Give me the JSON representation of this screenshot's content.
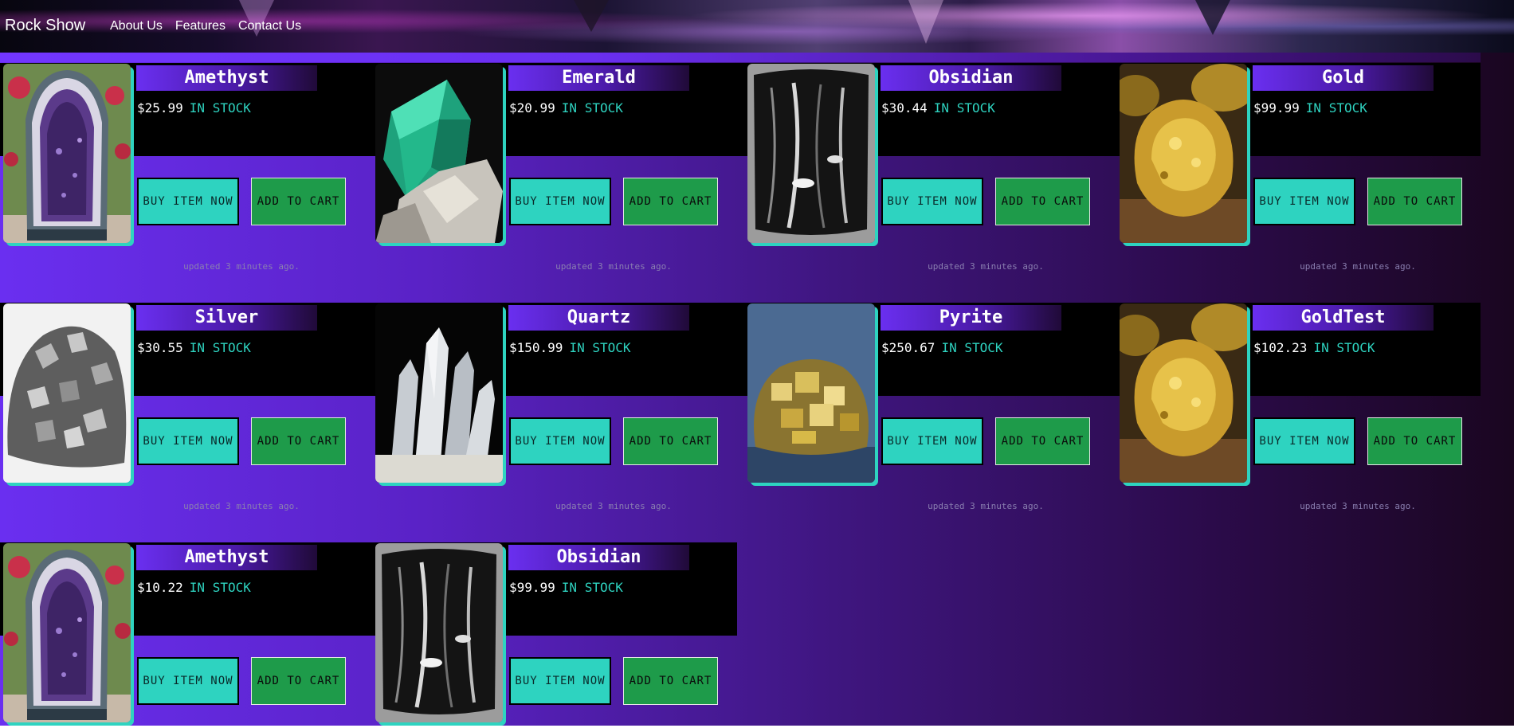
{
  "header": {
    "brand": "Rock Show",
    "nav": [
      "About Us",
      "Features",
      "Contact Us"
    ]
  },
  "products": [
    {
      "name": "Amethyst",
      "price": "$25.99",
      "stock": "IN STOCK",
      "buy": "BUY ITEM NOW",
      "cart": "ADD TO CART",
      "updated": "updated 3 minutes ago.",
      "image": "amethyst-geode"
    },
    {
      "name": "Emerald",
      "price": "$20.99",
      "stock": "IN STOCK",
      "buy": "BUY ITEM NOW",
      "cart": "ADD TO CART",
      "updated": "updated 3 minutes ago.",
      "image": "emerald-crystal"
    },
    {
      "name": "Obsidian",
      "price": "$30.44",
      "stock": "IN STOCK",
      "buy": "BUY ITEM NOW",
      "cart": "ADD TO CART",
      "updated": "updated 3 minutes ago.",
      "image": "obsidian-stone"
    },
    {
      "name": "Gold",
      "price": "$99.99",
      "stock": "IN STOCK",
      "buy": "BUY ITEM NOW",
      "cart": "ADD TO CART",
      "updated": "updated 3 minutes ago.",
      "image": "gold-nugget"
    },
    {
      "name": "Silver",
      "price": "$30.55",
      "stock": "IN STOCK",
      "buy": "BUY ITEM NOW",
      "cart": "ADD TO CART",
      "updated": "updated 3 minutes ago.",
      "image": "silver-cluster"
    },
    {
      "name": "Quartz",
      "price": "$150.99",
      "stock": "IN STOCK",
      "buy": "BUY ITEM NOW",
      "cart": "ADD TO CART",
      "updated": "updated 3 minutes ago.",
      "image": "quartz-cluster"
    },
    {
      "name": "Pyrite",
      "price": "$250.67",
      "stock": "IN STOCK",
      "buy": "BUY ITEM NOW",
      "cart": "ADD TO CART",
      "updated": "updated 3 minutes ago.",
      "image": "pyrite-cluster"
    },
    {
      "name": "GoldTest",
      "price": "$102.23",
      "stock": "IN STOCK",
      "buy": "BUY ITEM NOW",
      "cart": "ADD TO CART",
      "updated": "updated 3 minutes ago.",
      "image": "gold-nugget"
    },
    {
      "name": "Amethyst",
      "price": "$10.22",
      "stock": "IN STOCK",
      "buy": "BUY ITEM NOW",
      "cart": "ADD TO CART",
      "updated": "",
      "image": "amethyst-geode"
    },
    {
      "name": "Obsidian",
      "price": "$99.99",
      "stock": "IN STOCK",
      "buy": "BUY ITEM NOW",
      "cart": "ADD TO CART",
      "updated": "",
      "image": "obsidian-stone"
    }
  ],
  "colors": {
    "accent": "#2ed3c0",
    "cart_button": "#1e9b4a",
    "purple": "#6a2ff0"
  }
}
